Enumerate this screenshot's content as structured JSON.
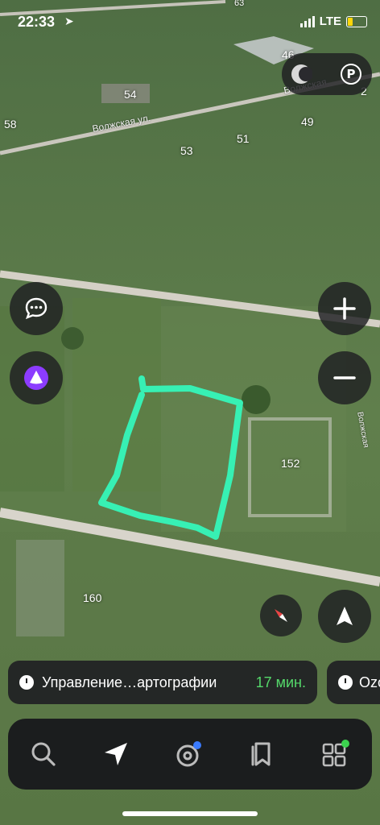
{
  "status_bar": {
    "time": "22:33",
    "network": "LTE"
  },
  "map": {
    "house_numbers": [
      "63",
      "46",
      "54",
      "58",
      "53",
      "51",
      "49",
      "2",
      "152",
      "160"
    ],
    "street_names": [
      "Волжская ул.",
      "Волжская",
      "Волжская"
    ]
  },
  "route": {
    "destination": "Управление…артографии",
    "eta": "17 мин.",
    "next_destination": "Ozo"
  },
  "tabs": [
    "search",
    "navigation",
    "music",
    "bookmarks",
    "services"
  ],
  "colors": {
    "drawn_outline": "#37f0b4",
    "eta_green": "#55d96b",
    "alice_purple": "#8c3cff",
    "badge_blue": "#3a7bff",
    "badge_green": "#3cd24f"
  },
  "icons": [
    "location-arrow-icon",
    "signal-icon",
    "battery-icon",
    "layers-icon",
    "parking-icon",
    "chat-icon",
    "alice-icon",
    "zoom-in-icon",
    "zoom-out-icon",
    "compass-icon",
    "my-location-icon",
    "clock-icon",
    "search-icon",
    "navigator-icon",
    "music-icon",
    "bookmarks-icon",
    "services-icon"
  ]
}
